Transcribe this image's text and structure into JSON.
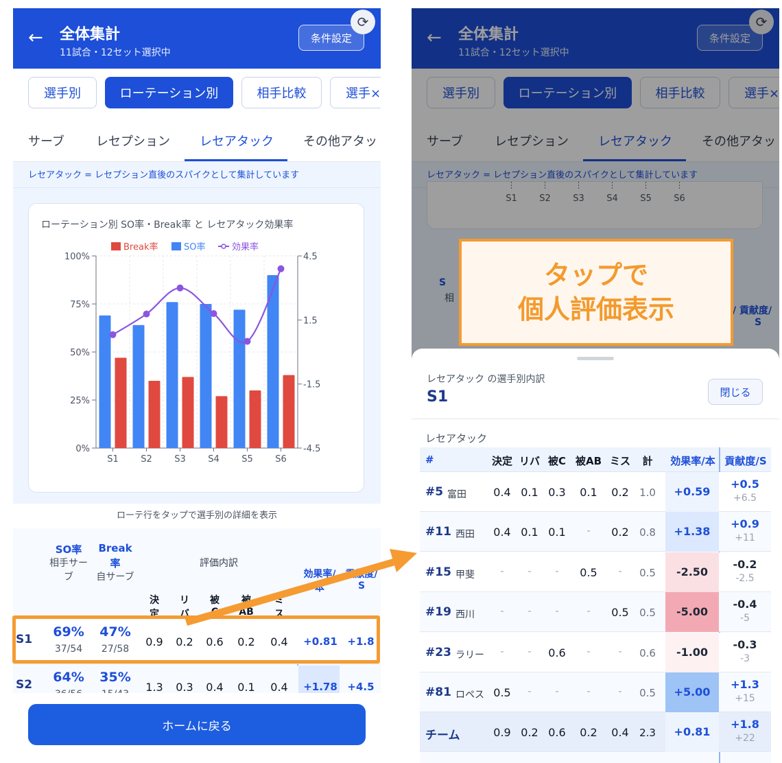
{
  "header": {
    "title": "全体集計",
    "subtitle": "11試合・12セット選択中",
    "condition_button": "条件設定",
    "back_icon": "arrow-left-icon",
    "refresh_icon": "refresh-icon"
  },
  "pills": [
    "選手別",
    "ローテーション別",
    "相手比較",
    "選手×"
  ],
  "tabs": [
    "サーブ",
    "レセプション",
    "レセアタック",
    "その他アタッ・"
  ],
  "note": "レセアタック = レセプション直後のスパイクとして集計しています",
  "chart_data": {
    "type": "bar",
    "title": "ローテーション別 SO率・Break率 と レセアタック効果率",
    "categories": [
      "S1",
      "S2",
      "S3",
      "S4",
      "S5",
      "S6"
    ],
    "series": [
      {
        "name": "Break率",
        "type": "bar",
        "color": "#e0493f",
        "values": [
          47,
          35,
          37,
          27,
          30,
          38
        ]
      },
      {
        "name": "SO率",
        "type": "bar",
        "color": "#4285f4",
        "values": [
          69,
          64,
          76,
          75,
          72,
          90
        ]
      },
      {
        "name": "効果率",
        "type": "line",
        "axis": "right",
        "color": "#8b55e0",
        "values": [
          0.81,
          1.78,
          3.0,
          1.8,
          0.5,
          3.9
        ]
      }
    ],
    "left_ticks": [
      "100%",
      "75%",
      "50%",
      "25%",
      "0%"
    ],
    "right_ticks": [
      "4.5",
      "1.5",
      "-1.5",
      "-4.5"
    ],
    "ylim": [
      0,
      100
    ],
    "y2lim": [
      -4.5,
      4.5
    ],
    "legend": "top",
    "grid": true
  },
  "tap_hint": "ローテ行をタップで選手別の詳細を表示",
  "rotation_table": {
    "col_so": [
      "SO率",
      "相手サー",
      "ブ"
    ],
    "col_break": [
      "Break",
      "率",
      "自サーブ"
    ],
    "col_eval": "評価内訳",
    "col_eff": [
      "効果率/",
      "本"
    ],
    "col_contrib": [
      "貢献度/",
      "S"
    ],
    "sub_cols": [
      [
        "決",
        "定"
      ],
      [
        "リ",
        "バ"
      ],
      [
        "被",
        "C"
      ],
      [
        "被",
        "AB"
      ],
      [
        "ミ",
        "ス"
      ]
    ],
    "rows": [
      {
        "rot": "S1",
        "so": "69%",
        "so_frac": "37/54",
        "brk": "47%",
        "brk_frac": "27/58",
        "vals": [
          "0.9",
          "0.2",
          "0.6",
          "0.2",
          "0.4"
        ],
        "eff": "+0.81",
        "contrib": "+1.8"
      },
      {
        "rot": "S2",
        "so": "64%",
        "so_frac": "36/56",
        "brk": "35%",
        "brk_frac": "15/43",
        "vals": [
          "1.3",
          "0.3",
          "0.4",
          "0.1",
          "0.4"
        ],
        "eff": "+1.78",
        "contrib": "+4.5"
      }
    ]
  },
  "home_button": "ホームに戻る",
  "callout": {
    "line1": "タップで",
    "line2": "個人評価表示"
  },
  "behind_visible": {
    "labels": [
      "S",
      "相"
    ],
    "right_header": [
      "/ 貢献度/",
      "S"
    ]
  },
  "sheet": {
    "subtitle": "レセアタック の選手別内訳",
    "title": "S1",
    "close": "閉じる",
    "section": "レセアタック",
    "headers": [
      "#",
      "決定",
      "リバ",
      "被C",
      "被AB",
      "ミス",
      "計",
      "効果率/本",
      "貢献度/S"
    ],
    "players": [
      {
        "num": "#5",
        "name": "富田",
        "vals": [
          "0.4",
          "0.1",
          "0.3",
          "0.1",
          "0.2"
        ],
        "total": "1.0",
        "eff": "+0.59",
        "contrib": "+0.5",
        "contrib_sub": "+6.5"
      },
      {
        "num": "#11",
        "name": "西田",
        "vals": [
          "0.4",
          "0.1",
          "0.1",
          "-",
          "0.2"
        ],
        "total": "0.8",
        "eff": "+1.38",
        "contrib": "+0.9",
        "contrib_sub": "+11"
      },
      {
        "num": "#15",
        "name": "甲斐",
        "vals": [
          "-",
          "-",
          "-",
          "0.5",
          "-"
        ],
        "total": "0.5",
        "eff": "-2.50",
        "contrib": "-0.2",
        "contrib_sub": "-2.5"
      },
      {
        "num": "#19",
        "name": "西川",
        "vals": [
          "-",
          "-",
          "-",
          "-",
          "0.5"
        ],
        "total": "0.5",
        "eff": "-5.00",
        "contrib": "-0.4",
        "contrib_sub": "-5"
      },
      {
        "num": "#23",
        "name": "ラリー",
        "vals": [
          "-",
          "-",
          "0.6",
          "-",
          "-"
        ],
        "total": "0.6",
        "eff": "-1.00",
        "contrib": "-0.3",
        "contrib_sub": "-3"
      },
      {
        "num": "#81",
        "name": "ロペス",
        "vals": [
          "0.5",
          "-",
          "-",
          "-",
          "-"
        ],
        "total": "0.5",
        "eff": "+5.00",
        "contrib": "+1.3",
        "contrib_sub": "+15"
      }
    ],
    "team": {
      "label": "チーム",
      "vals": [
        "0.9",
        "0.2",
        "0.6",
        "0.2",
        "0.4"
      ],
      "total": "2.3",
      "eff": "+0.81",
      "contrib": "+1.8",
      "contrib_sub": "+22"
    }
  },
  "colors": {
    "primary": "#1d4fd8",
    "break": "#e0493f",
    "so": "#4285f4",
    "effect": "#8b55e0",
    "highlight": "#f59b32"
  }
}
